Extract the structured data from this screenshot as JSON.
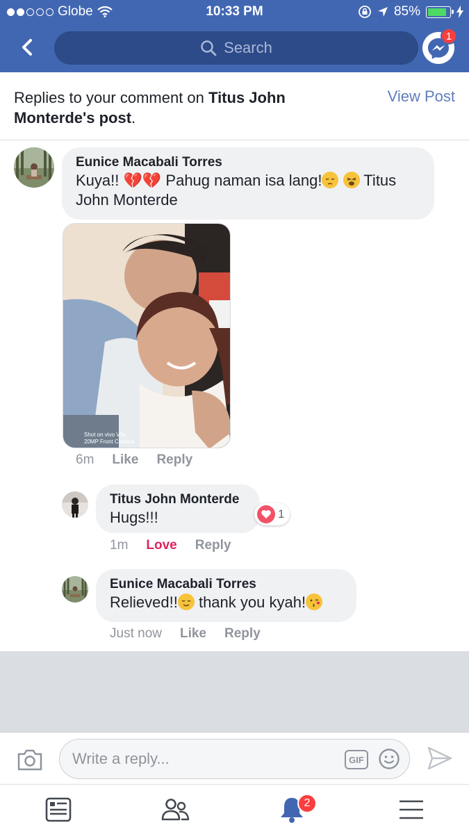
{
  "status_bar": {
    "carrier": "Globe",
    "time": "10:33 PM",
    "battery": "85%",
    "battery_level": 0.85
  },
  "header": {
    "search_placeholder": "Search",
    "messenger_badge": "1"
  },
  "title": {
    "prefix": "Replies to your comment on ",
    "author": "Titus John Monterde",
    "suffix_bold": "'s post",
    "end": ".",
    "view_post": "View Post"
  },
  "comments": [
    {
      "name": "Eunice Macabali Torres",
      "text_a": "Kuya!! ",
      "text_b": " Pahug naman isa lang!",
      "text_c": " Titus John Monterde",
      "time": "6m",
      "like": "Like",
      "reply": "Reply"
    },
    {
      "name": "Titus John Monterde",
      "text": "Hugs!!!",
      "reaction_count": "1",
      "time": "1m",
      "like": "Love",
      "reply": "Reply"
    },
    {
      "name": "Eunice Macabali Torres",
      "text_a": "Relieved!!",
      "text_b": " thank you kyah!",
      "time": "Just now",
      "like": "Like",
      "reply": "Reply"
    }
  ],
  "photo": {
    "watermark_line1": "Shot on vivo V5s",
    "watermark_line2": "20MP Front Camera"
  },
  "composer": {
    "placeholder": "Write a reply...",
    "gif_label": "GIF"
  },
  "tabbar": {
    "notifications_badge": "2"
  },
  "colors": {
    "brand": "#4267b2",
    "love": "#e0245e",
    "badge": "#fa3e3e"
  },
  "icons": [
    "back-icon",
    "search-icon",
    "messenger-icon",
    "camera-icon",
    "gif-icon",
    "emoji-icon",
    "send-icon",
    "news-feed-icon",
    "friends-icon",
    "notifications-icon",
    "menu-icon",
    "broken-heart-icon",
    "pensive-emoji-icon",
    "weary-emoji-icon",
    "relieved-emoji-icon",
    "kiss-emoji-icon",
    "heart-reaction-icon"
  ]
}
